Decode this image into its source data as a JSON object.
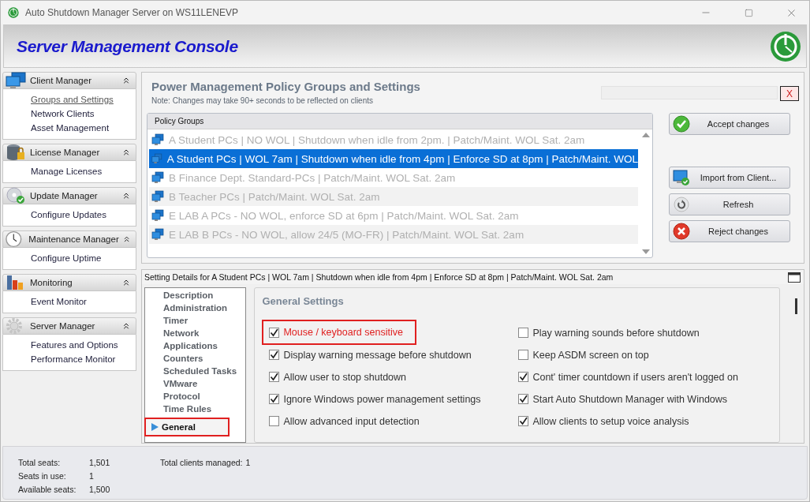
{
  "window": {
    "title": "Auto Shutdown Manager Server on WS11LENEVP"
  },
  "header": {
    "title": "Server Management Console"
  },
  "sidebar": {
    "groups": [
      {
        "kind": "client",
        "title": "Client Manager",
        "expanded": true,
        "items": [
          {
            "label": "Groups and Settings",
            "selected": true
          },
          {
            "label": "Network Clients",
            "selected": false
          },
          {
            "label": "Asset Management",
            "selected": false
          }
        ]
      },
      {
        "kind": "license",
        "title": "License Manager",
        "expanded": true,
        "items": [
          {
            "label": "Manage Licenses",
            "selected": false
          }
        ]
      },
      {
        "kind": "update",
        "title": "Update  Manager",
        "expanded": true,
        "items": [
          {
            "label": "Configure Updates",
            "selected": false
          }
        ]
      },
      {
        "kind": "maintenance",
        "title": "Maintenance Manager",
        "expanded": true,
        "items": [
          {
            "label": "Configure Uptime",
            "selected": false
          }
        ]
      },
      {
        "kind": "monitoring",
        "title": "Monitoring",
        "expanded": true,
        "items": [
          {
            "label": "Event Monitor",
            "selected": false
          }
        ]
      },
      {
        "kind": "server",
        "title": "Server Manager",
        "expanded": true,
        "items": [
          {
            "label": "Features and Options",
            "selected": false
          },
          {
            "label": "Performance Monitor",
            "selected": false
          }
        ]
      }
    ]
  },
  "policy": {
    "title": "Power Management Policy Groups and Settings",
    "note": "Note: Changes may take 90+ seconds to be reflected on clients",
    "close_button": "X",
    "groups_header": "Policy Groups",
    "rows": [
      {
        "label": "A Student PCs | NO WOL | Shutdown when idle from 2pm. | Patch/Maint. WOL Sat. 2am",
        "selected": false,
        "disabled": true
      },
      {
        "label": "A Student PCs | WOL 7am | Shutdown when idle from 4pm | Enforce SD at 8pm | Patch/Maint. WOL",
        "selected": true,
        "disabled": false
      },
      {
        "label": "B Finance Dept. Standard-PCs | Patch/Maint. WOL Sat. 2am",
        "selected": false,
        "disabled": true
      },
      {
        "label": "B Teacher PCs | Patch/Maint. WOL Sat. 2am",
        "selected": false,
        "disabled": true
      },
      {
        "label": "E LAB A PCs - NO WOL, enforce SD at 6pm | Patch/Maint. WOL Sat. 2am",
        "selected": false,
        "disabled": true
      },
      {
        "label": "E LAB B PCs - NO WOL, allow 24/5 (MO-FR) | Patch/Maint. WOL Sat. 2am",
        "selected": false,
        "disabled": true
      }
    ],
    "buttons": [
      {
        "kind": "accept",
        "label": "Accept changes"
      },
      {
        "kind": "import",
        "label": "Import from  Client..."
      },
      {
        "kind": "refresh",
        "label": "Refresh"
      },
      {
        "kind": "reject",
        "label": "Reject changes"
      }
    ]
  },
  "details": {
    "title": "Setting Details for A Student PCs | WOL 7am | Shutdown when idle from 4pm | Enforce SD at 8pm | Patch/Maint. WOL Sat. 2am",
    "nav": [
      {
        "label": "Description",
        "selected": false
      },
      {
        "label": "Administration",
        "selected": false
      },
      {
        "label": "Timer",
        "selected": false
      },
      {
        "label": "Network",
        "selected": false
      },
      {
        "label": "Applications",
        "selected": false
      },
      {
        "label": "Counters",
        "selected": false
      },
      {
        "label": "Scheduled Tasks",
        "selected": false
      },
      {
        "label": "VMware",
        "selected": false
      },
      {
        "label": "Protocol",
        "selected": false
      },
      {
        "label": "Time Rules",
        "selected": false
      },
      {
        "label": "General",
        "selected": true
      }
    ],
    "section_title": "General Settings",
    "left_options": [
      {
        "label": "Mouse / keyboard  sensitive",
        "checked": true,
        "highlighted": true
      },
      {
        "label": "Display warning message before shutdown",
        "checked": true,
        "highlighted": false
      },
      {
        "label": "Allow user to stop shutdown",
        "checked": true,
        "highlighted": false
      },
      {
        "label": "Ignore Windows power management settings",
        "checked": true,
        "highlighted": false
      },
      {
        "label": "Allow advanced input detection",
        "checked": false,
        "highlighted": false
      }
    ],
    "right_options": [
      {
        "label": "Play warning sounds before shutdown",
        "checked": false,
        "highlighted": false
      },
      {
        "label": "Keep ASDM screen on top",
        "checked": false,
        "highlighted": false
      },
      {
        "label": "Cont' timer countdown if users aren't logged on",
        "checked": true,
        "highlighted": false
      },
      {
        "label": "Start Auto Shutdown Manager with  Windows",
        "checked": true,
        "highlighted": false
      },
      {
        "label": "Allow clients to setup  voice analysis",
        "checked": true,
        "highlighted": false
      }
    ]
  },
  "status_bar": {
    "stats": [
      {
        "label": "Total seats:",
        "value": "1,501"
      },
      {
        "label": "Seats in use:",
        "value": "1"
      },
      {
        "label": "Available seats:",
        "value": "1,500"
      }
    ],
    "clients_label": "Total clients managed:",
    "clients_value": "1"
  }
}
